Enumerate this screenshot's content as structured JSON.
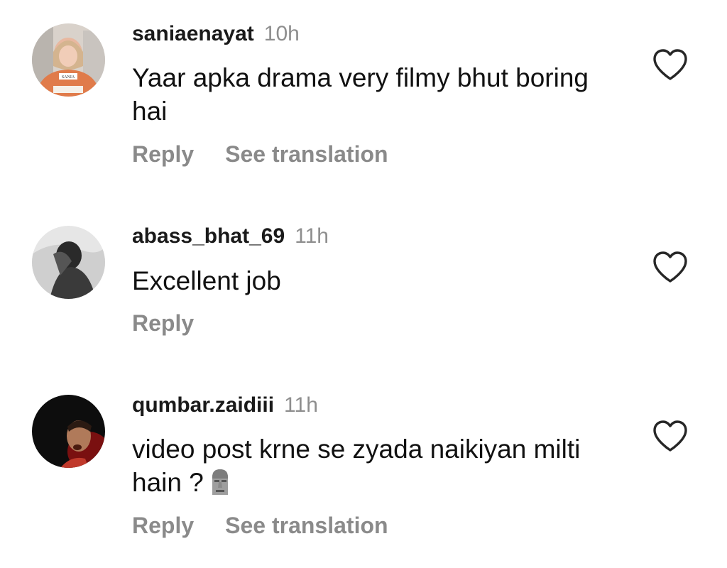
{
  "comments": [
    {
      "username": "saniaenayat",
      "time": "10h",
      "text": "Yaar apka drama very filmy bhut boring hai",
      "actions": {
        "reply": "Reply",
        "translate": "See translation"
      },
      "avatar_badge": "SANIA"
    },
    {
      "username": "abass_bhat_69",
      "time": "11h",
      "text": "Excellent job",
      "actions": {
        "reply": "Reply"
      }
    },
    {
      "username": "qumbar.zaidiii",
      "time": "11h",
      "text": "video post krne se zyada naikiyan milti hain ?",
      "emoji": "moai-emoji",
      "actions": {
        "reply": "Reply",
        "translate": "See translation"
      }
    }
  ],
  "icons": {
    "like": "heart-outline-icon"
  },
  "colors": {
    "username": "#1a1a1a",
    "meta": "#8e8e8e",
    "action": "#8a8a8a",
    "text": "#111111"
  }
}
